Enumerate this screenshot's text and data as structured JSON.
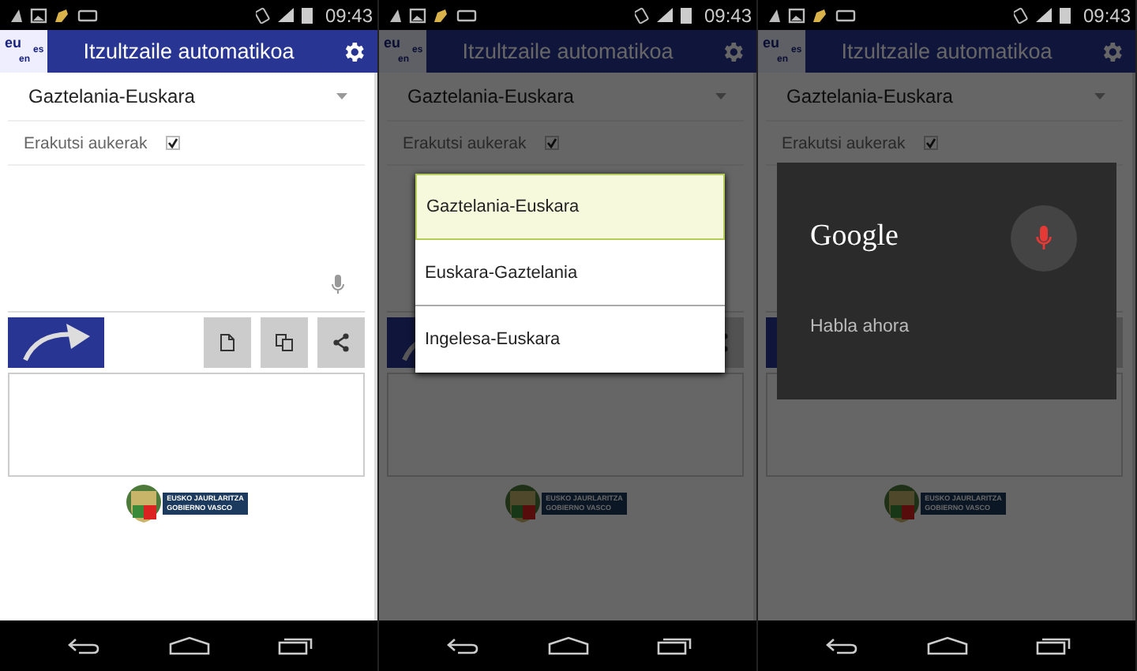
{
  "screens": [
    {
      "status_time": "09:43",
      "app_bar": {
        "logo": [
          "eu",
          "en",
          "es"
        ],
        "title": "Itzultzaile automatikoa"
      },
      "language": "Gaztelania-Euskara",
      "show_options": {
        "label": "Erakutsi aukerak",
        "checked": true
      },
      "footer_logo": [
        "EUSKO JAURLARITZA",
        "GOBIERNO VASCO"
      ]
    },
    {
      "status_time": "09:43",
      "app_bar": {
        "logo": [
          "eu",
          "en",
          "es"
        ],
        "title": "Itzultzaile automatikoa"
      },
      "language": "Gaztelania-Euskara",
      "show_options": {
        "label": "Erakutsi aukerak",
        "checked": true
      },
      "footer_logo": [
        "EUSKO JAURLARITZA",
        "GOBIERNO VASCO"
      ],
      "overlay": {
        "kind": "dropdown",
        "options": [
          {
            "label": "Gaztelania-Euskara",
            "selected": true
          },
          {
            "label": "Euskara-Gaztelania",
            "selected": false
          },
          {
            "label": "Ingelesa-Euskara",
            "selected": false
          }
        ]
      }
    },
    {
      "status_time": "09:43",
      "app_bar": {
        "logo": [
          "eu",
          "en",
          "es"
        ],
        "title": "Itzultzaile automatikoa"
      },
      "language": "Gaztelania-Euskara",
      "show_options": {
        "label": "Erakutsi aukerak",
        "checked": true
      },
      "footer_logo": [
        "EUSKO JAURLARITZA",
        "GOBIERNO VASCO"
      ],
      "overlay": {
        "kind": "voice",
        "title": "Google",
        "prompt": "Habla ahora"
      }
    }
  ]
}
